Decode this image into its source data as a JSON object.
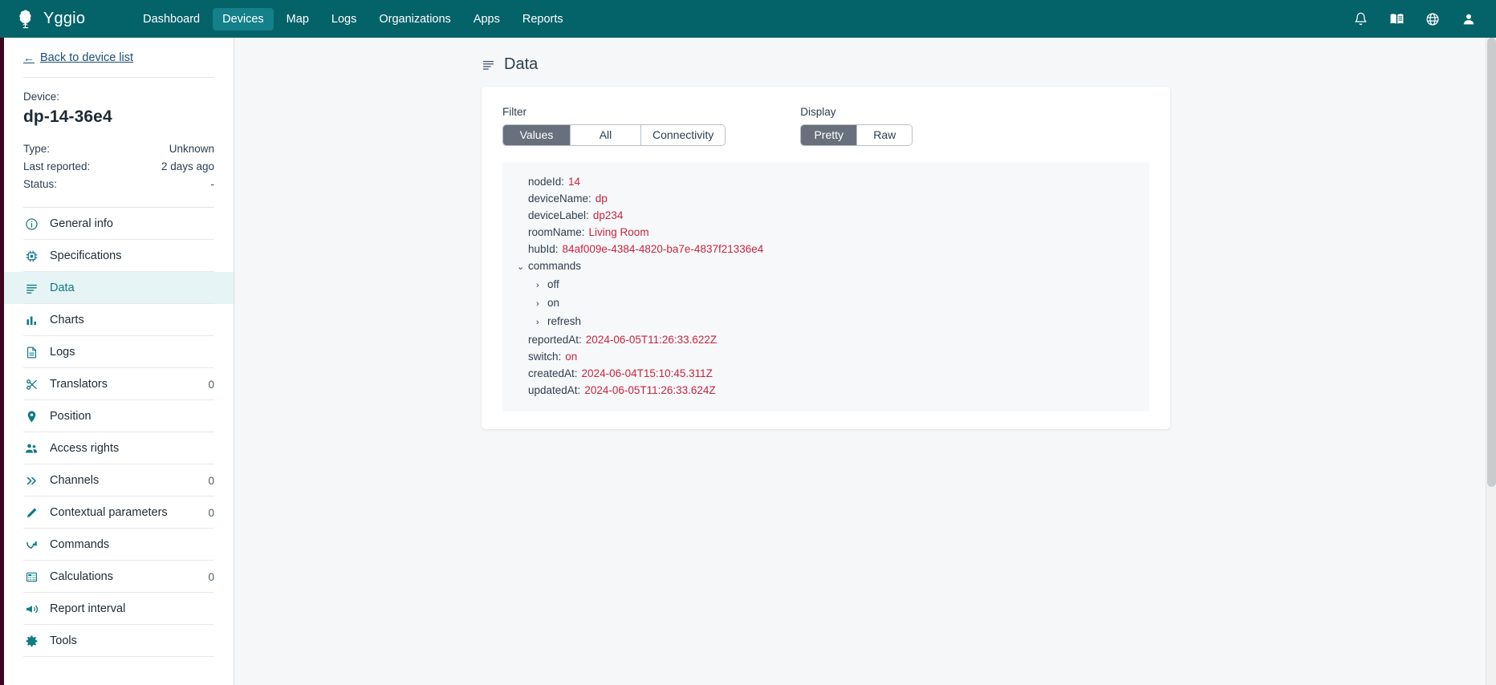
{
  "navbar": {
    "brand": "Yggio",
    "brand_logo_icon": "tree-icon",
    "background_color": "#046269",
    "active_color": "#13808a",
    "links": [
      {
        "label": "Dashboard",
        "active": false
      },
      {
        "label": "Devices",
        "active": true
      },
      {
        "label": "Map",
        "active": false
      },
      {
        "label": "Logs",
        "active": false
      },
      {
        "label": "Organizations",
        "active": false
      },
      {
        "label": "Apps",
        "active": false
      },
      {
        "label": "Reports",
        "active": false
      }
    ],
    "icons": [
      {
        "name": "bell-icon",
        "title": "Notifications"
      },
      {
        "name": "book-icon",
        "title": "Documentation"
      },
      {
        "name": "globe-icon",
        "title": "Language"
      },
      {
        "name": "user-icon",
        "title": "Account"
      }
    ]
  },
  "sidebar": {
    "back_link": "Back to device list",
    "back_arrow": "←",
    "device_caption": "Device:",
    "device_name": "dp-14-36e4",
    "meta": [
      {
        "label": "Type:",
        "value": "Unknown"
      },
      {
        "label": "Last reported:",
        "value": "2 days ago"
      },
      {
        "label": "Status:",
        "value": "-"
      }
    ],
    "items": [
      {
        "label": "General info",
        "icon": "info-circle-icon",
        "count": "",
        "active": false
      },
      {
        "label": "Specifications",
        "icon": "chip-icon",
        "count": "",
        "active": false
      },
      {
        "label": "Data",
        "icon": "lines-icon",
        "count": "",
        "active": true
      },
      {
        "label": "Charts",
        "icon": "bar-chart-icon",
        "count": "",
        "active": false
      },
      {
        "label": "Logs",
        "icon": "document-icon",
        "count": "",
        "active": false
      },
      {
        "label": "Translators",
        "icon": "scissors-icon",
        "count": "0",
        "active": false
      },
      {
        "label": "Position",
        "icon": "map-pin-icon",
        "count": "",
        "active": false
      },
      {
        "label": "Access rights",
        "icon": "people-icon",
        "count": "",
        "active": false
      },
      {
        "label": "Channels",
        "icon": "double-chevron-right-icon",
        "count": "0",
        "active": false
      },
      {
        "label": "Contextual parameters",
        "icon": "pencil-icon",
        "count": "0",
        "active": false
      },
      {
        "label": "Commands",
        "icon": "arrow-turn-icon",
        "count": "",
        "active": false
      },
      {
        "label": "Calculations",
        "icon": "calculator-icon",
        "count": "0",
        "active": false
      },
      {
        "label": "Report interval",
        "icon": "megaphone-icon",
        "count": "",
        "active": false
      },
      {
        "label": "Tools",
        "icon": "gear-icon",
        "count": "",
        "active": false
      }
    ]
  },
  "main": {
    "page_title": "Data",
    "page_title_icon": "lines-icon",
    "filter": {
      "label": "Filter",
      "options": [
        "Values",
        "All",
        "Connectivity"
      ],
      "selected": "Values"
    },
    "display": {
      "label": "Display",
      "options": [
        "Pretty",
        "Raw"
      ],
      "selected": "Pretty"
    },
    "json": {
      "value_color": "#c7253e",
      "lines": [
        {
          "level": 0,
          "caret": "",
          "key": "nodeId:",
          "value": "14"
        },
        {
          "level": 0,
          "caret": "",
          "key": "deviceName:",
          "value": "dp"
        },
        {
          "level": 0,
          "caret": "",
          "key": "deviceLabel:",
          "value": "dp234"
        },
        {
          "level": 0,
          "caret": "",
          "key": "roomName:",
          "value": "Living Room"
        },
        {
          "level": 0,
          "caret": "",
          "key": "hubId:",
          "value": "84af009e-4384-4820-ba7e-4837f21336e4"
        },
        {
          "level": 0,
          "caret": "⌄",
          "key": "commands",
          "value": ""
        },
        {
          "level": 1,
          "caret": "›",
          "key": "off",
          "value": ""
        },
        {
          "level": 1,
          "caret": "›",
          "key": "on",
          "value": ""
        },
        {
          "level": 1,
          "caret": "›",
          "key": "refresh",
          "value": ""
        },
        {
          "level": 0,
          "caret": "",
          "key": "reportedAt:",
          "value": "2024-06-05T11:26:33.622Z"
        },
        {
          "level": 0,
          "caret": "",
          "key": "switch:",
          "value": "on"
        },
        {
          "level": 0,
          "caret": "",
          "key": "createdAt:",
          "value": "2024-06-04T15:10:45.311Z"
        },
        {
          "level": 0,
          "caret": "",
          "key": "updatedAt:",
          "value": "2024-06-05T11:26:33.624Z"
        }
      ]
    }
  }
}
